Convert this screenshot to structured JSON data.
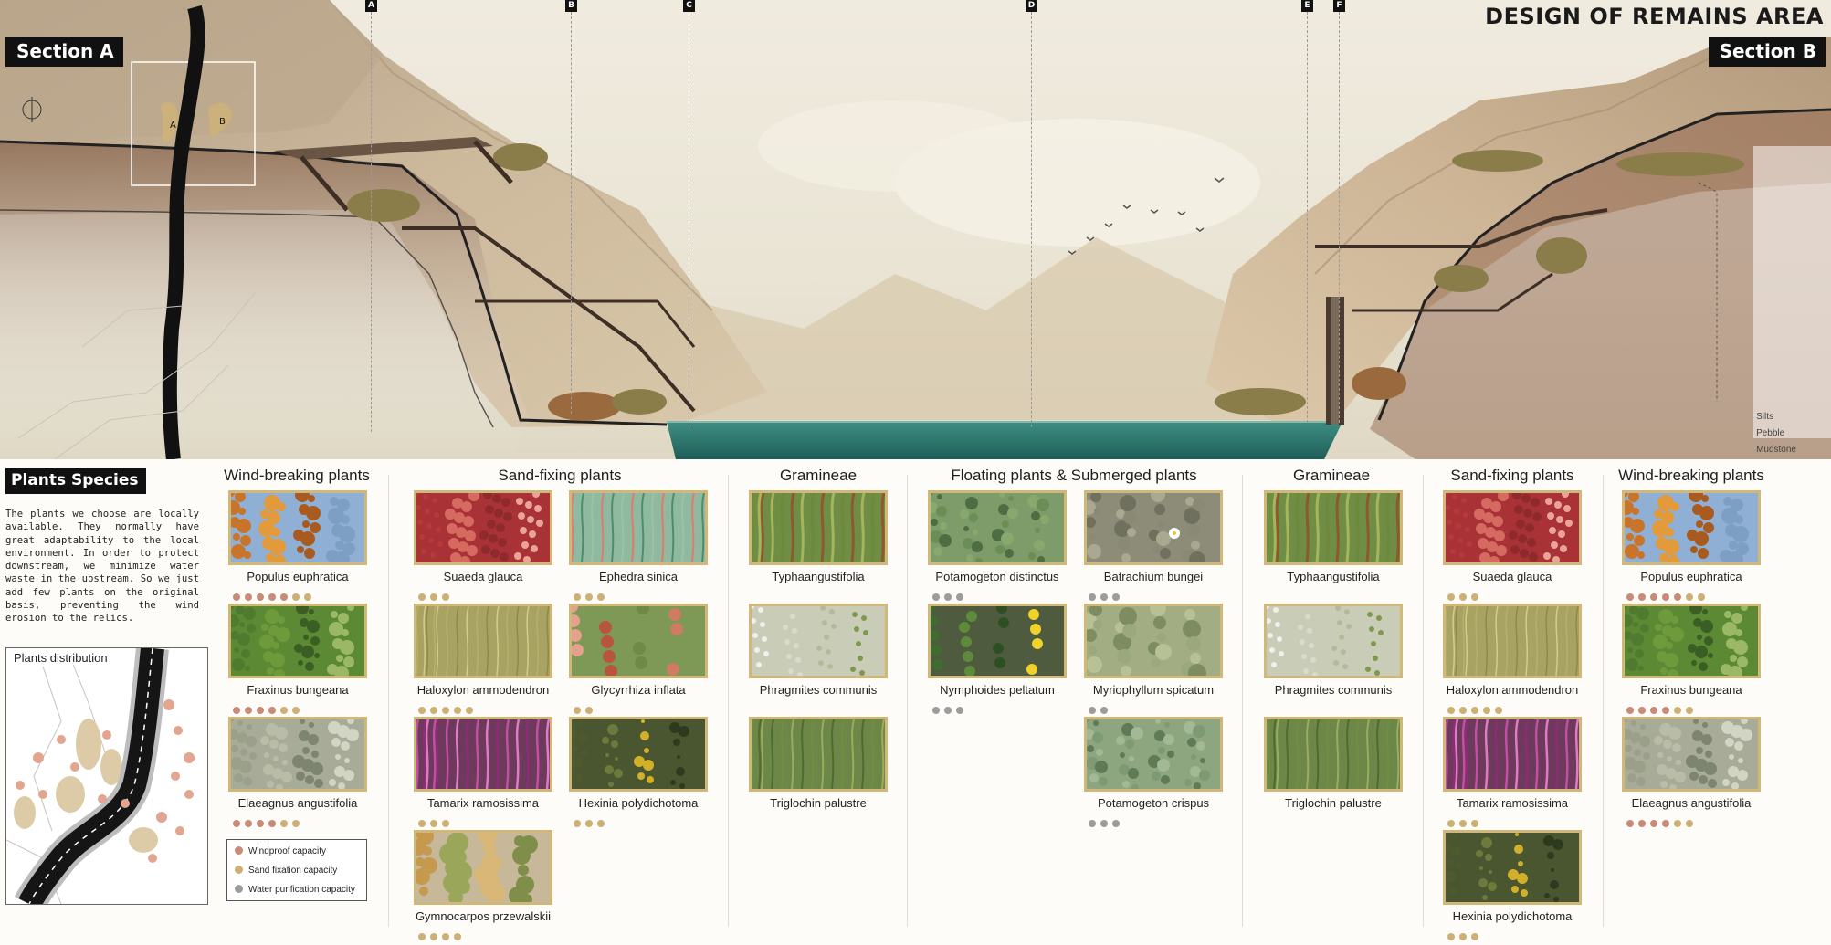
{
  "header": {
    "title": "DESIGN OF REMAINS AREA",
    "section_a": "Section A",
    "section_b": "Section B",
    "markers": [
      "A",
      "B",
      "C",
      "D",
      "E",
      "F"
    ],
    "key_map_labels": [
      "A",
      "B"
    ],
    "strata": [
      "Silts",
      "Pebble",
      "Mudstone"
    ]
  },
  "plants": {
    "title": "Plants Species",
    "description": "The plants we choose are locally available. They normally have great adaptability to the local environment. In order to protect downstream, we minimize water waste in the upstream. So we just add few plants on the original basis, preventing the wind erosion to the relics.",
    "distribution_label": "Plants distribution",
    "capacity_legend": [
      {
        "label": "Windproof capacity",
        "color": "#c98a78"
      },
      {
        "label": "Sand fixation capacity",
        "color": "#cdb074"
      },
      {
        "label": "Water purification capacity",
        "color": "#9c9c9c"
      }
    ],
    "columns": [
      {
        "title": "Wind-breaking plants"
      },
      {
        "title": "Sand-fixing plants"
      },
      {
        "title": "Gramineae"
      },
      {
        "title": "Floating plants & Submerged plants"
      },
      {
        "title": "Gramineae"
      },
      {
        "title": "Sand-fixing plants"
      },
      {
        "title": "Wind-breaking plants"
      }
    ],
    "cards": [
      {
        "name": "Populus euphratica",
        "dots": 7,
        "type": "wind",
        "photo": "orange"
      },
      {
        "name": "Fraxinus bungeana",
        "dots": 6,
        "type": "wind",
        "photo": "green"
      },
      {
        "name": "Elaeagnus angustifolia",
        "dots": 6,
        "type": "wind",
        "photo": "silver"
      },
      {
        "name": "Suaeda glauca",
        "dots": 3,
        "type": "sand",
        "photo": "red"
      },
      {
        "name": "Haloxylon ammodendron",
        "dots": 5,
        "type": "sand",
        "photo": "olive"
      },
      {
        "name": "Tamarix ramosissima",
        "dots": 3,
        "type": "sand",
        "photo": "pink"
      },
      {
        "name": "Gymnocarpos przewalskii",
        "dots": 4,
        "type": "sand",
        "photo": "shrub"
      },
      {
        "name": "Ephedra sinica",
        "dots": 3,
        "type": "sand",
        "photo": "ephedra"
      },
      {
        "name": "Glycyrrhiza inflata",
        "dots": 2,
        "type": "sand",
        "photo": "pods"
      },
      {
        "name": "Hexinia polydichotoma",
        "dots": 3,
        "type": "sand",
        "photo": "weed"
      },
      {
        "name": "Typhaangustifolia",
        "dots": 0,
        "type": "water",
        "photo": "reed"
      },
      {
        "name": "Phragmites communis",
        "dots": 0,
        "type": "water",
        "photo": "plume"
      },
      {
        "name": "Triglochin palustre",
        "dots": 0,
        "type": "water",
        "photo": "grass"
      },
      {
        "name": "Potamogeton distinctus",
        "dots": 3,
        "type": "water",
        "photo": "pond"
      },
      {
        "name": "Nymphoides peltatum",
        "dots": 3,
        "type": "water",
        "photo": "lily"
      },
      {
        "name": "Batrachium bungei",
        "dots": 3,
        "type": "water",
        "photo": "flowerwater"
      },
      {
        "name": "Myriophyllum spicatum",
        "dots": 2,
        "type": "water",
        "photo": "submerged"
      },
      {
        "name": "Potamogeton crispus",
        "dots": 3,
        "type": "water",
        "photo": "crispus"
      },
      {
        "name": "Typhaangustifolia",
        "dots": 0,
        "type": "water",
        "photo": "reed"
      },
      {
        "name": "Phragmites communis",
        "dots": 0,
        "type": "water",
        "photo": "plume"
      },
      {
        "name": "Triglochin palustre",
        "dots": 0,
        "type": "water",
        "photo": "grass"
      },
      {
        "name": "Suaeda glauca",
        "dots": 3,
        "type": "sand",
        "photo": "red"
      },
      {
        "name": "Haloxylon ammodendron",
        "dots": 5,
        "type": "sand",
        "photo": "olive"
      },
      {
        "name": "Tamarix ramosissima",
        "dots": 3,
        "type": "sand",
        "photo": "pink"
      },
      {
        "name": "Hexinia polydichotoma",
        "dots": 3,
        "type": "sand",
        "photo": "weed"
      },
      {
        "name": "Populus euphratica",
        "dots": 7,
        "type": "wind",
        "photo": "orange"
      },
      {
        "name": "Fraxinus bungeana",
        "dots": 6,
        "type": "wind",
        "photo": "green"
      },
      {
        "name": "Elaeagnus angustifolia",
        "dots": 6,
        "type": "wind",
        "photo": "silver"
      }
    ]
  }
}
